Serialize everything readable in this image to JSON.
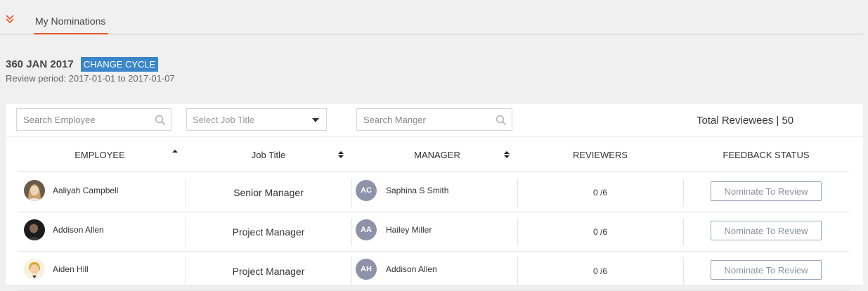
{
  "tabs": {
    "active_label": "My Nominations"
  },
  "cycle": {
    "name": "360 JAN 2017",
    "change_label": "CHANGE CYCLE",
    "review_period": "Review period: 2017-01-01 to 2017-01-07"
  },
  "filters": {
    "search_employee_placeholder": "Search Employee",
    "job_title_placeholder": "Select Job Title",
    "search_manager_placeholder": "Search Manger",
    "total_reviewees": "Total Reviewees | 50"
  },
  "columns": {
    "employee": "EMPLOYEE",
    "job_title": "Job Title",
    "manager": "MANAGER",
    "reviewers": "REVIEWERS",
    "feedback_status": "FEEDBACK STATUS"
  },
  "rows": [
    {
      "employee": "Aaliyah Campbell",
      "job_title": "Senior Manager",
      "manager_initials": "AC",
      "manager": "Saphina S Smith",
      "reviewers": "0 /6",
      "action": "Nominate To Review"
    },
    {
      "employee": "Addison Allen",
      "job_title": "Project Manager",
      "manager_initials": "AA",
      "manager": "Hailey Miller",
      "reviewers": "0 /6",
      "action": "Nominate To Review"
    },
    {
      "employee": "Aiden Hill",
      "job_title": "Project Manager",
      "manager_initials": "AH",
      "manager": "Addison Allen",
      "reviewers": "0 /6",
      "action": "Nominate To Review"
    }
  ],
  "colors": {
    "accent": "#e8582b",
    "change_cycle_bg": "#3a86c8",
    "manager_avatar_bg": "#8f93a9"
  }
}
